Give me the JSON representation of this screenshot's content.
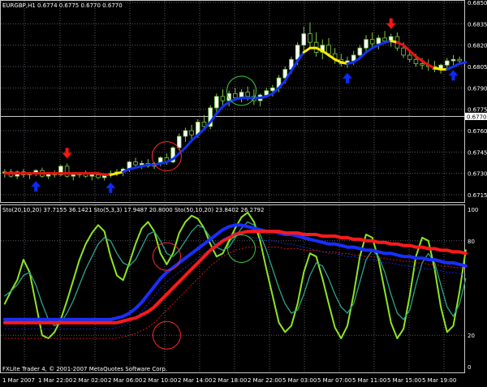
{
  "colors": {
    "background": "#000000",
    "grid": "#5a5a6a",
    "panel_border": "#c8c8c8",
    "bull_candle": "#ffffff",
    "bear_candle": "#000000",
    "candle_wick": "#7ac943",
    "ma_blue": "#1133ee",
    "ma_yellow": "#ffee00",
    "ma_red": "#ee1111",
    "arrow_up": "#0a2bff",
    "arrow_down": "#ff1414",
    "circle_red": "#ff2a2a",
    "circle_green": "#3ecc3e",
    "stoch_fast": "#8fe620",
    "stoch_mid": "#2aa58a",
    "stoch_slow_main": "#1a2eff",
    "stoch_slow_signal": "#ff1a1a"
  },
  "price_panel": {
    "symbol_line": "EURGBP,H1  0.6774 0.6775 0.6770 0.6770",
    "price_ticks": [
      "0.6850",
      "0.6835",
      "0.6820",
      "0.6805",
      "0.6790",
      "0.6775",
      "0.6760",
      "0.6745",
      "0.6730",
      "0.6715"
    ],
    "current_price_label": "0.6770"
  },
  "indicator_panel": {
    "header": "Sto(20,10,20) 37.7155 36.1421  Sto(5,3,3) 17.9487 20.8000  Sto(50,10,20) 23.8402 26.2792",
    "level_ticks": [
      "100",
      "80",
      "20",
      "0"
    ]
  },
  "time_axis": [
    "1 Mar 2007",
    "1 Mar 22:00",
    "2 Mar 02:00",
    "2 Mar 06:00",
    "2 Mar 10:00",
    "2 Mar 14:00",
    "2 Mar 18:00",
    "2 Mar 22:00",
    "5 Mar 03:00",
    "5 Mar 07:00",
    "5 Mar 11:00",
    "5 Mar 15:00",
    "5 Mar 19:00"
  ],
  "footer": "FXLite Trader 4, © 2001-2007 MetaQuotes Software Corp.",
  "chart_data": {
    "type": "candlestick",
    "price_axis_range": [
      0.6715,
      0.685
    ],
    "indicator_axis_range": [
      0,
      100
    ],
    "stochastic_levels": [
      80,
      20
    ],
    "current_price": 0.677,
    "candles": [
      {
        "o": 0.673,
        "h": 0.6733,
        "l": 0.6727,
        "c": 0.6731
      },
      {
        "o": 0.6731,
        "h": 0.6733,
        "l": 0.6727,
        "c": 0.6728
      },
      {
        "o": 0.6728,
        "h": 0.6732,
        "l": 0.6726,
        "c": 0.6731
      },
      {
        "o": 0.6731,
        "h": 0.6733,
        "l": 0.6727,
        "c": 0.6729
      },
      {
        "o": 0.6729,
        "h": 0.6731,
        "l": 0.6726,
        "c": 0.673
      },
      {
        "o": 0.673,
        "h": 0.6733,
        "l": 0.6728,
        "c": 0.6732
      },
      {
        "o": 0.6732,
        "h": 0.6734,
        "l": 0.6727,
        "c": 0.6728
      },
      {
        "o": 0.6728,
        "h": 0.6731,
        "l": 0.6726,
        "c": 0.673
      },
      {
        "o": 0.673,
        "h": 0.6732,
        "l": 0.6727,
        "c": 0.6729
      },
      {
        "o": 0.6729,
        "h": 0.6736,
        "l": 0.6728,
        "c": 0.6735
      },
      {
        "o": 0.6735,
        "h": 0.6737,
        "l": 0.6727,
        "c": 0.6728
      },
      {
        "o": 0.6728,
        "h": 0.6731,
        "l": 0.6725,
        "c": 0.6729
      },
      {
        "o": 0.6729,
        "h": 0.6731,
        "l": 0.6727,
        "c": 0.673
      },
      {
        "o": 0.673,
        "h": 0.6732,
        "l": 0.6727,
        "c": 0.6728
      },
      {
        "o": 0.6728,
        "h": 0.673,
        "l": 0.6725,
        "c": 0.6729
      },
      {
        "o": 0.6729,
        "h": 0.6731,
        "l": 0.6726,
        "c": 0.6727
      },
      {
        "o": 0.6727,
        "h": 0.673,
        "l": 0.6725,
        "c": 0.6729
      },
      {
        "o": 0.6729,
        "h": 0.6732,
        "l": 0.6727,
        "c": 0.673
      },
      {
        "o": 0.673,
        "h": 0.6733,
        "l": 0.6728,
        "c": 0.6731
      },
      {
        "o": 0.6731,
        "h": 0.6734,
        "l": 0.6728,
        "c": 0.6733
      },
      {
        "o": 0.6733,
        "h": 0.6739,
        "l": 0.6731,
        "c": 0.6738
      },
      {
        "o": 0.6738,
        "h": 0.6741,
        "l": 0.6734,
        "c": 0.6736
      },
      {
        "o": 0.6736,
        "h": 0.6739,
        "l": 0.6733,
        "c": 0.6737
      },
      {
        "o": 0.6737,
        "h": 0.674,
        "l": 0.6734,
        "c": 0.6735
      },
      {
        "o": 0.6735,
        "h": 0.6738,
        "l": 0.6733,
        "c": 0.6737
      },
      {
        "o": 0.6737,
        "h": 0.6742,
        "l": 0.6735,
        "c": 0.6741
      },
      {
        "o": 0.6741,
        "h": 0.6744,
        "l": 0.6736,
        "c": 0.6738
      },
      {
        "o": 0.6738,
        "h": 0.6749,
        "l": 0.6737,
        "c": 0.6748
      },
      {
        "o": 0.6748,
        "h": 0.6758,
        "l": 0.6746,
        "c": 0.6756
      },
      {
        "o": 0.6756,
        "h": 0.6762,
        "l": 0.6752,
        "c": 0.676
      },
      {
        "o": 0.676,
        "h": 0.6764,
        "l": 0.6754,
        "c": 0.6757
      },
      {
        "o": 0.6757,
        "h": 0.6768,
        "l": 0.6755,
        "c": 0.6766
      },
      {
        "o": 0.6766,
        "h": 0.6771,
        "l": 0.676,
        "c": 0.6763
      },
      {
        "o": 0.6763,
        "h": 0.6778,
        "l": 0.6761,
        "c": 0.6776
      },
      {
        "o": 0.6776,
        "h": 0.6786,
        "l": 0.6773,
        "c": 0.6784
      },
      {
        "o": 0.6784,
        "h": 0.6789,
        "l": 0.6778,
        "c": 0.6781
      },
      {
        "o": 0.6781,
        "h": 0.6788,
        "l": 0.6777,
        "c": 0.6786
      },
      {
        "o": 0.6786,
        "h": 0.679,
        "l": 0.6781,
        "c": 0.6783
      },
      {
        "o": 0.6783,
        "h": 0.6789,
        "l": 0.678,
        "c": 0.6787
      },
      {
        "o": 0.6787,
        "h": 0.6791,
        "l": 0.6781,
        "c": 0.6784
      },
      {
        "o": 0.6784,
        "h": 0.6789,
        "l": 0.6778,
        "c": 0.6781
      },
      {
        "o": 0.6781,
        "h": 0.6786,
        "l": 0.6777,
        "c": 0.6785
      },
      {
        "o": 0.6785,
        "h": 0.679,
        "l": 0.6783,
        "c": 0.6788
      },
      {
        "o": 0.6788,
        "h": 0.6792,
        "l": 0.6784,
        "c": 0.679
      },
      {
        "o": 0.679,
        "h": 0.6799,
        "l": 0.6787,
        "c": 0.6797
      },
      {
        "o": 0.6797,
        "h": 0.6805,
        "l": 0.6793,
        "c": 0.6803
      },
      {
        "o": 0.6803,
        "h": 0.6812,
        "l": 0.68,
        "c": 0.681
      },
      {
        "o": 0.681,
        "h": 0.6822,
        "l": 0.6806,
        "c": 0.682
      },
      {
        "o": 0.682,
        "h": 0.6833,
        "l": 0.6816,
        "c": 0.6828
      },
      {
        "o": 0.6828,
        "h": 0.6836,
        "l": 0.6818,
        "c": 0.6822
      },
      {
        "o": 0.6822,
        "h": 0.6829,
        "l": 0.6812,
        "c": 0.6815
      },
      {
        "o": 0.6815,
        "h": 0.6824,
        "l": 0.681,
        "c": 0.682
      },
      {
        "o": 0.682,
        "h": 0.6825,
        "l": 0.6812,
        "c": 0.6814
      },
      {
        "o": 0.6814,
        "h": 0.6818,
        "l": 0.6807,
        "c": 0.681
      },
      {
        "o": 0.681,
        "h": 0.6814,
        "l": 0.6805,
        "c": 0.6807
      },
      {
        "o": 0.6807,
        "h": 0.6812,
        "l": 0.6804,
        "c": 0.6809
      },
      {
        "o": 0.6809,
        "h": 0.6816,
        "l": 0.6806,
        "c": 0.6813
      },
      {
        "o": 0.6813,
        "h": 0.682,
        "l": 0.681,
        "c": 0.6818
      },
      {
        "o": 0.6818,
        "h": 0.6827,
        "l": 0.6815,
        "c": 0.6824
      },
      {
        "o": 0.6824,
        "h": 0.6829,
        "l": 0.6818,
        "c": 0.6821
      },
      {
        "o": 0.6821,
        "h": 0.6827,
        "l": 0.6817,
        "c": 0.6825
      },
      {
        "o": 0.6825,
        "h": 0.683,
        "l": 0.6821,
        "c": 0.6823
      },
      {
        "o": 0.6823,
        "h": 0.6828,
        "l": 0.6819,
        "c": 0.6826
      },
      {
        "o": 0.6826,
        "h": 0.6829,
        "l": 0.6816,
        "c": 0.6818
      },
      {
        "o": 0.6818,
        "h": 0.6822,
        "l": 0.6811,
        "c": 0.6813
      },
      {
        "o": 0.6813,
        "h": 0.6816,
        "l": 0.6808,
        "c": 0.681
      },
      {
        "o": 0.681,
        "h": 0.6814,
        "l": 0.6805,
        "c": 0.6807
      },
      {
        "o": 0.6807,
        "h": 0.6811,
        "l": 0.6803,
        "c": 0.6806
      },
      {
        "o": 0.6806,
        "h": 0.681,
        "l": 0.6802,
        "c": 0.6805
      },
      {
        "o": 0.6805,
        "h": 0.6809,
        "l": 0.6801,
        "c": 0.6803
      },
      {
        "o": 0.6803,
        "h": 0.6807,
        "l": 0.68,
        "c": 0.6806
      },
      {
        "o": 0.6806,
        "h": 0.6811,
        "l": 0.6803,
        "c": 0.6809
      },
      {
        "o": 0.6809,
        "h": 0.6813,
        "l": 0.6806,
        "c": 0.681
      },
      {
        "o": 0.681,
        "h": 0.6812,
        "l": 0.6807,
        "c": 0.6809
      }
    ],
    "ma_fast": [
      0.673,
      0.673,
      0.673,
      0.673,
      0.673,
      0.673,
      0.673,
      0.673,
      0.673,
      0.673,
      0.673,
      0.673,
      0.673,
      0.673,
      0.673,
      0.673,
      0.6729,
      0.6729,
      0.673,
      0.6731,
      0.6733,
      0.6734,
      0.6735,
      0.6736,
      0.6736,
      0.6737,
      0.6738,
      0.674,
      0.6744,
      0.6748,
      0.6753,
      0.6757,
      0.6761,
      0.6766,
      0.6772,
      0.6777,
      0.678,
      0.6782,
      0.6783,
      0.6783,
      0.6783,
      0.6783,
      0.6784,
      0.6786,
      0.679,
      0.6795,
      0.6802,
      0.6809,
      0.6815,
      0.6818,
      0.6818,
      0.6816,
      0.6813,
      0.681,
      0.6808,
      0.6807,
      0.6808,
      0.6811,
      0.6815,
      0.6818,
      0.682,
      0.6822,
      0.6823,
      0.6822,
      0.682,
      0.6816,
      0.6812,
      0.6809,
      0.6806,
      0.6804,
      0.6803,
      0.6803,
      0.6805,
      0.6807,
      0.6808
    ],
    "ma_fast_color": [
      "r",
      "r",
      "r",
      "r",
      "r",
      "r",
      "r",
      "r",
      "r",
      "r",
      "r",
      "r",
      "r",
      "r",
      "r",
      "r",
      "r",
      "r",
      "y",
      "y",
      "b",
      "b",
      "b",
      "b",
      "b",
      "b",
      "b",
      "b",
      "b",
      "b",
      "b",
      "b",
      "b",
      "b",
      "b",
      "b",
      "b",
      "b",
      "b",
      "b",
      "b",
      "b",
      "b",
      "b",
      "b",
      "b",
      "b",
      "b",
      "b",
      "y",
      "y",
      "y",
      "y",
      "y",
      "y",
      "y",
      "b",
      "b",
      "b",
      "b",
      "b",
      "b",
      "b",
      "y",
      "r",
      "r",
      "r",
      "r",
      "r",
      "r",
      "y",
      "y",
      "b",
      "b",
      "b"
    ],
    "arrows": [
      {
        "bar": 5,
        "dir": "up"
      },
      {
        "bar": 10,
        "dir": "down"
      },
      {
        "bar": 17,
        "dir": "up"
      },
      {
        "bar": 55,
        "dir": "up"
      },
      {
        "bar": 62,
        "dir": "down"
      },
      {
        "bar": 72,
        "dir": "up"
      }
    ],
    "highlight_circles": [
      {
        "panel": "price",
        "bar": 26,
        "price": 0.6742,
        "color": "red"
      },
      {
        "panel": "price",
        "bar": 38,
        "price": 0.6788,
        "color": "green"
      },
      {
        "panel": "indicator",
        "bar": 26,
        "value": 70,
        "color": "red"
      },
      {
        "panel": "indicator",
        "bar": 26,
        "value": 20,
        "color": "red"
      },
      {
        "panel": "indicator",
        "bar": 38,
        "value": 75,
        "color": "green"
      }
    ],
    "series": [
      {
        "name": "Sto(5,3,3)",
        "values": [
          40,
          48,
          55,
          68,
          60,
          40,
          20,
          18,
          22,
          30,
          42,
          55,
          68,
          78,
          85,
          90,
          86,
          70,
          58,
          55,
          66,
          78,
          88,
          92,
          86,
          72,
          65,
          72,
          85,
          92,
          96,
          94,
          88,
          78,
          70,
          72,
          80,
          88,
          95,
          98,
          92,
          80,
          62,
          45,
          28,
          22,
          26,
          40,
          60,
          72,
          70,
          56,
          40,
          25,
          18,
          26,
          46,
          70,
          84,
          82,
          68,
          48,
          28,
          18,
          24,
          45,
          70,
          82,
          80,
          62,
          38,
          22,
          26,
          48,
          74
        ]
      },
      {
        "name": "Sto(20,10,20)",
        "values": [
          45,
          48,
          52,
          58,
          60,
          52,
          40,
          30,
          26,
          28,
          34,
          42,
          52,
          62,
          70,
          78,
          82,
          80,
          72,
          66,
          64,
          68,
          76,
          84,
          86,
          80,
          72,
          70,
          74,
          80,
          86,
          90,
          88,
          82,
          76,
          74,
          76,
          82,
          88,
          92,
          90,
          84,
          74,
          62,
          50,
          40,
          34,
          36,
          46,
          58,
          66,
          64,
          56,
          46,
          38,
          34,
          40,
          54,
          68,
          74,
          70,
          60,
          46,
          34,
          30,
          36,
          52,
          66,
          72,
          66,
          52,
          38,
          32,
          40,
          56
        ]
      },
      {
        "name": "Sto(50,10,20) main",
        "values": [
          30,
          30,
          30,
          30,
          30,
          30,
          30,
          30,
          30,
          30,
          30,
          30,
          30,
          30,
          30,
          30,
          30,
          30,
          31,
          32,
          34,
          37,
          41,
          46,
          51,
          56,
          60,
          63,
          66,
          69,
          72,
          75,
          78,
          81,
          84,
          87,
          89,
          90,
          90,
          89,
          88,
          87,
          86,
          86,
          85,
          84,
          84,
          83,
          82,
          81,
          80,
          79,
          78,
          78,
          77,
          76,
          76,
          75,
          74,
          74,
          73,
          72,
          72,
          71,
          70,
          70,
          69,
          69,
          68,
          68,
          67,
          66,
          66,
          65,
          64
        ]
      },
      {
        "name": "Sto(50,10,20) signal",
        "values": [
          28,
          28,
          28,
          28,
          28,
          28,
          28,
          28,
          28,
          28,
          28,
          28,
          28,
          28,
          28,
          28,
          28,
          28,
          28,
          29,
          30,
          31,
          33,
          35,
          38,
          42,
          46,
          50,
          54,
          58,
          62,
          66,
          70,
          74,
          77,
          80,
          82,
          84,
          85,
          86,
          86,
          86,
          86,
          86,
          86,
          85,
          85,
          85,
          84,
          84,
          84,
          83,
          83,
          83,
          82,
          82,
          81,
          81,
          80,
          80,
          79,
          79,
          78,
          78,
          77,
          77,
          76,
          76,
          75,
          75,
          74,
          74,
          73,
          73,
          72
        ]
      }
    ]
  }
}
